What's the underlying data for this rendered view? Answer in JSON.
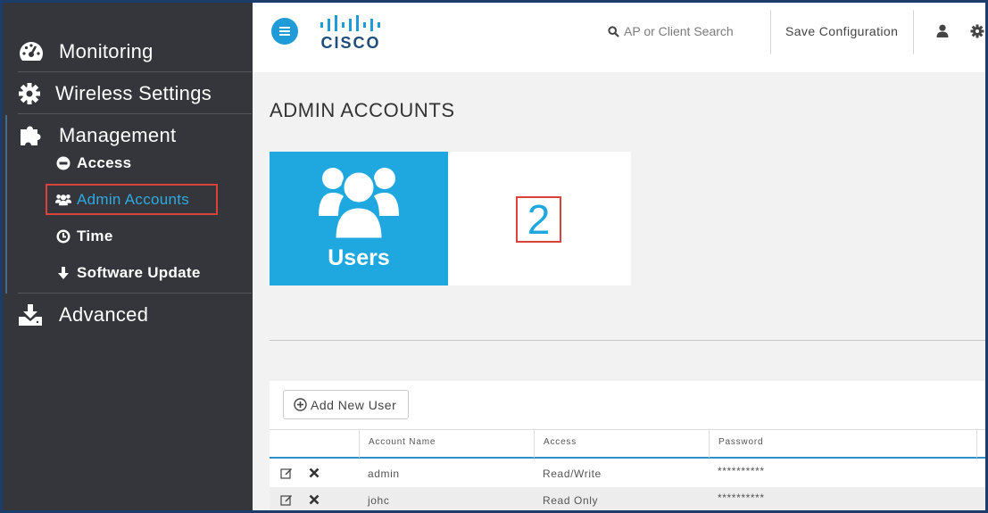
{
  "sidebar": {
    "main_items": [
      {
        "label": "Monitoring",
        "icon": "dashboard-icon"
      },
      {
        "label": "Wireless Settings",
        "icon": "gear-icon"
      },
      {
        "label": "Management",
        "icon": "puzzle-icon"
      },
      {
        "label": "Advanced",
        "icon": "download-icon"
      }
    ],
    "management_items": [
      {
        "label": "Access",
        "icon": "minus-circle-icon"
      },
      {
        "label": "Admin Accounts",
        "icon": "users-icon"
      },
      {
        "label": "Time",
        "icon": "clock-icon"
      },
      {
        "label": "Software Update",
        "icon": "arrow-down-icon"
      }
    ],
    "active_item": "Admin Accounts"
  },
  "header": {
    "logo_text": "CISCO",
    "search_placeholder": "AP or Client Search",
    "save_label": "Save Configuration"
  },
  "main": {
    "page_title": "ADMIN ACCOUNTS",
    "tile": {
      "label": "Users",
      "count": "2"
    },
    "add_button_label": "Add New User",
    "table": {
      "columns": [
        "Account Name",
        "Access",
        "Password"
      ],
      "rows": [
        {
          "name": "admin",
          "access": "Read/Write",
          "password": "**********"
        },
        {
          "name": "johc",
          "access": "Read Only",
          "password": "**********"
        }
      ]
    }
  },
  "colors": {
    "sidebar_bg": "#34363b",
    "accent_blue": "#1fa8e0",
    "highlight_red": "#d9433b"
  }
}
